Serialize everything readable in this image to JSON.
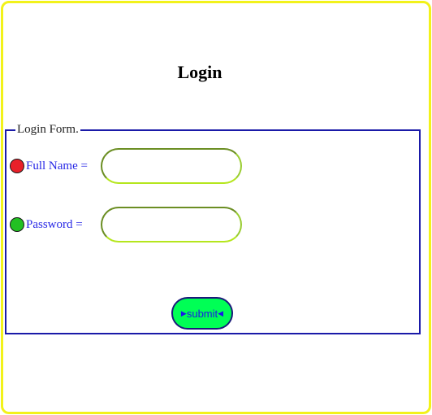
{
  "page": {
    "title": "Login"
  },
  "form": {
    "legend": "Login Form.",
    "full_name": {
      "label": "Full Name =",
      "value": "",
      "indicator_color": "#e8202a"
    },
    "password": {
      "label": "Password =",
      "value": "",
      "indicator_color": "#22c022"
    },
    "submit": {
      "label": "submit",
      "left_arrow": "▶",
      "right_arrow": "◀"
    }
  },
  "colors": {
    "frame_border": "#f2f21a",
    "fieldset_border": "#1a1aa8",
    "label_text": "#2828e6",
    "submit_bg": "#00ff55"
  }
}
